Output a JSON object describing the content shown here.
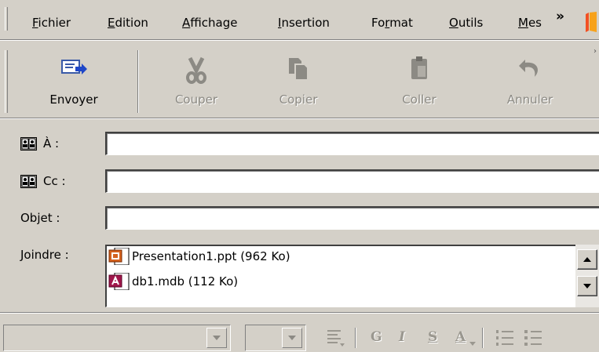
{
  "menu": {
    "items": [
      {
        "pre": "",
        "u": "F",
        "post": "ichier"
      },
      {
        "pre": "",
        "u": "E",
        "post": "dition"
      },
      {
        "pre": "",
        "u": "A",
        "post": "ffichage"
      },
      {
        "pre": "",
        "u": "I",
        "post": "nsertion"
      },
      {
        "pre": "Fo",
        "u": "r",
        "post": "mat"
      },
      {
        "pre": "",
        "u": "O",
        "post": "utils"
      },
      {
        "pre": "",
        "u": "M",
        "post": "es"
      }
    ],
    "overflow_label": "»"
  },
  "toolbar": {
    "send_label": "Envoyer",
    "cut_label": "Couper",
    "copy_label": "Copier",
    "paste_label": "Coller",
    "undo_label": "Annuler"
  },
  "fields": {
    "to_label": "À :",
    "cc_label": "Cc :",
    "subject_label": "Objet :",
    "attach_label": "Joindre :",
    "to_value": "",
    "cc_value": "",
    "subject_value": ""
  },
  "attachments": [
    {
      "name": "Presentation1.ppt (962 Ko)",
      "icon": "powerpoint-file-icon"
    },
    {
      "name": "db1.mdb (112 Ko)",
      "icon": "access-file-icon"
    }
  ],
  "format_toolbar": {
    "font_name": "",
    "font_size": "",
    "bold_glyph": "G",
    "italic_glyph": "I",
    "underline_glyph": "S",
    "color_glyph": "A"
  },
  "colors": {
    "chrome": "#d4d0c8",
    "disabled_text": "#8c8a84",
    "field_background": "#ffffff"
  }
}
